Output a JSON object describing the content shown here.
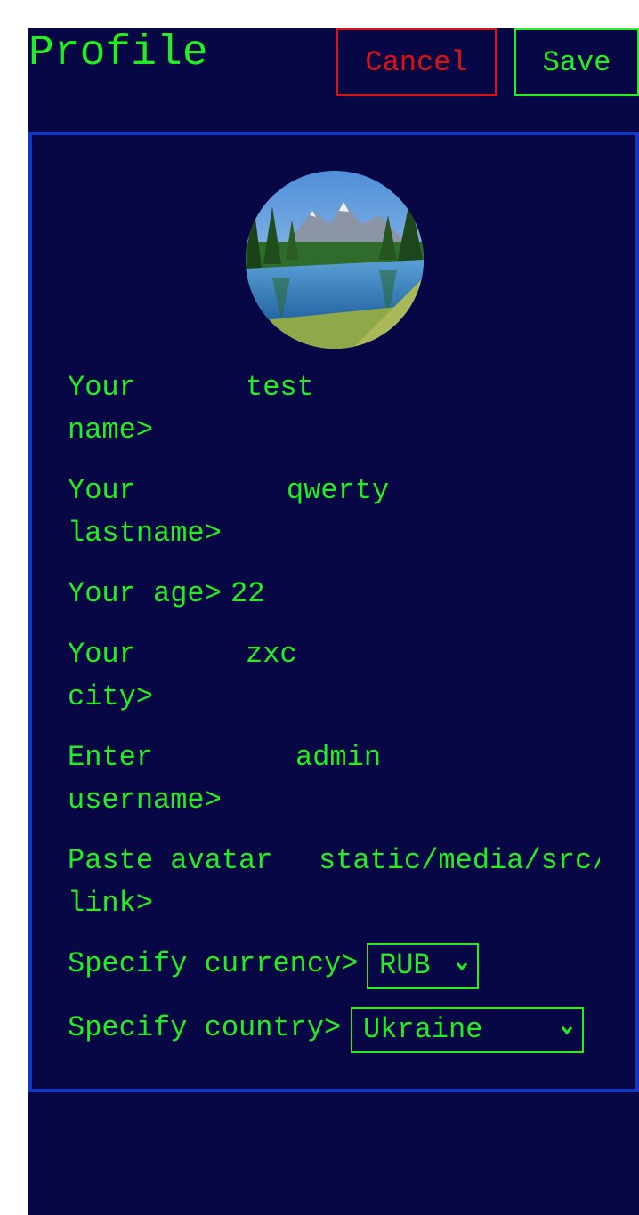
{
  "header": {
    "title": "Profile",
    "cancel_label": "Cancel",
    "save_label": "Save"
  },
  "form": {
    "name_label": "Your name>",
    "name_value": "test",
    "lastname_label": "Your lastname>",
    "lastname_value": "qwerty",
    "age_label": "Your age>",
    "age_value": "22",
    "city_label": "Your city>",
    "city_value": "zxc",
    "username_label": "Enter username>",
    "username_value": "admin",
    "avatar_label": "Paste avatar link>",
    "avatar_value": "static/media/src/",
    "currency_label": "Specify currency>",
    "currency_value": "RUB",
    "country_label": "Specify country>",
    "country_value": "Ukraine"
  },
  "colors": {
    "background": "#070745",
    "text": "#22ee22",
    "cancel": "#dd1111",
    "card_border": "#0f37c8"
  },
  "icons": {
    "avatar": "landscape-avatar-image",
    "dropdown": "chevron-down-icon"
  }
}
